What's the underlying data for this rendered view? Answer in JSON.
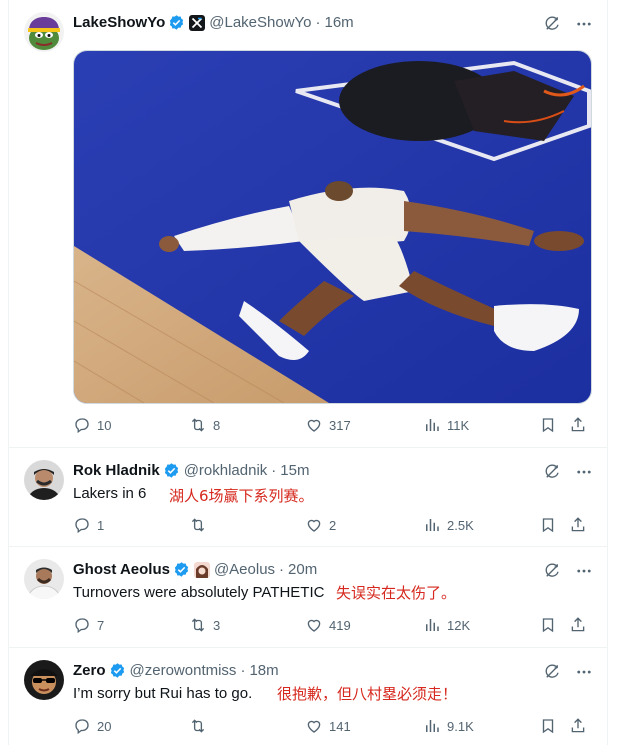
{
  "colors": {
    "verified": "#1d9bf0",
    "annotation": "#d6281e",
    "muted": "#536471"
  },
  "tweets": [
    {
      "name": "LakeShowYo",
      "handle": "@LakeShowYo",
      "time": "16m",
      "text": "",
      "translation": "",
      "has_media": true,
      "media_icon": "basketball-player-lying-on-court-image",
      "affiliate_icon": "x-logo-badge",
      "stats": {
        "replies": "10",
        "reposts": "8",
        "likes": "317",
        "views": "11K"
      }
    },
    {
      "name": "Rok Hladnik",
      "handle": "@rokhladnik",
      "time": "15m",
      "text": "Lakers in 6",
      "translation": "湖人6场赢下系列赛。",
      "stats": {
        "replies": "1",
        "reposts": "",
        "likes": "2",
        "views": "2.5K"
      }
    },
    {
      "name": "Ghost Aeolus",
      "handle": "@Aeolus",
      "time": "20m",
      "text": "Turnovers were absolutely PATHETIC",
      "translation": "失误实在太伤了。",
      "affiliate_icon": "anime-avatar-badge",
      "stats": {
        "replies": "7",
        "reposts": "3",
        "likes": "419",
        "views": "12K"
      }
    },
    {
      "name": "Zero",
      "handle": "@zerowontmiss",
      "time": "18m",
      "text": "I’m sorry but Rui has to go.",
      "translation": "很抱歉，但八村塁必须走！",
      "stats": {
        "replies": "20",
        "reposts": "",
        "likes": "141",
        "views": "9.1K"
      }
    }
  ],
  "separator": "·"
}
